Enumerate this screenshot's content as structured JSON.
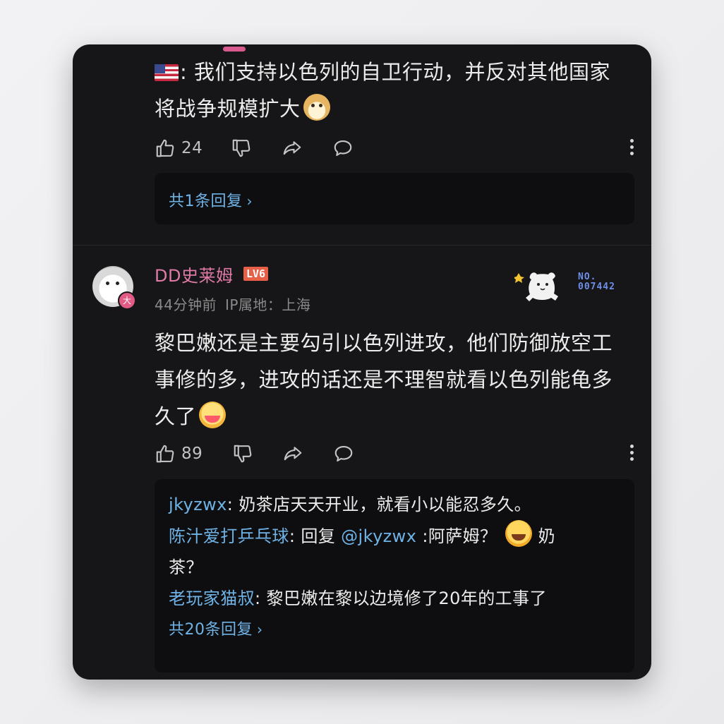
{
  "comment1": {
    "text_line1": ": 我们支持以色列的自卫行动，并反对其他国家",
    "text_line2": "将战争规模扩大",
    "flag_icon": "us-flag-emoji",
    "emoji_icon": "doge-emoji",
    "likes": "24",
    "reply_total": "共1条回复"
  },
  "comment2": {
    "username": "DD史莱姆",
    "level": "LV6",
    "avatar_badge": "大",
    "time": "44分钟前",
    "ip": "IP属地：上海",
    "decor_no": "NO.",
    "decor_num": "007442",
    "text_line1": "黎巴嫩还是主要勾引以色列进攻，他们防御放空工",
    "text_line2": "事修的多，进攻的话还是不理智就看以色列能龟多",
    "text_line3": "久了",
    "emoji_icon": "shy-emoji",
    "likes": "89",
    "replies": [
      {
        "user": "jkyzwx",
        "text": ": 奶茶店天天开业，就看小以能忍多久。"
      },
      {
        "user": "陈汁爱打乒乓球",
        "text_a": ": 回复 ",
        "mention": "@jkyzwx",
        "text_b": " :阿萨姆？",
        "text_c": "奶",
        "text_d": "茶？"
      },
      {
        "user": "老玩家猫叔",
        "text": ": 黎巴嫩在黎以边境修了20年的工事了"
      }
    ],
    "reply_total": "共20条回复"
  },
  "colors": {
    "background": "#161618",
    "username": "#e07aa7",
    "link": "#6fb3e6",
    "level_badge": "#e85f47"
  }
}
